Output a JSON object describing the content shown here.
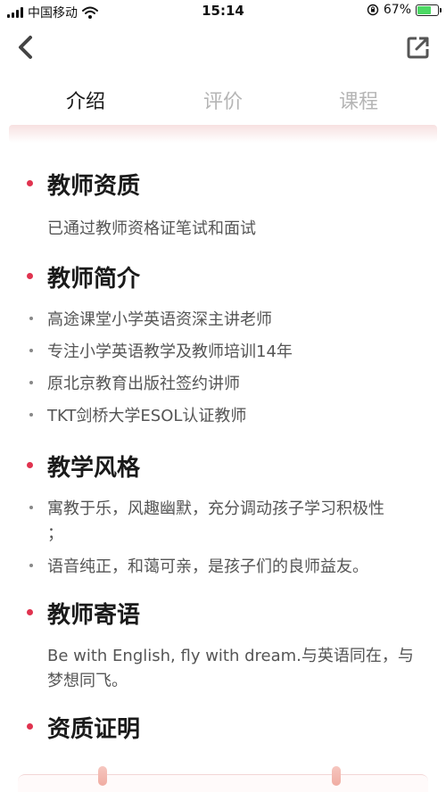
{
  "status_bar": {
    "carrier": "中国移动",
    "time": "15:14",
    "battery": "67%",
    "battery_level": 0.67
  },
  "tabs": [
    {
      "label": "介绍",
      "active": true
    },
    {
      "label": "评价",
      "active": false
    },
    {
      "label": "课程",
      "active": false
    }
  ],
  "colors": {
    "accent_dot": "#e0334f",
    "text_main": "#1a1a1a",
    "text_body": "#555555",
    "tab_inactive": "#b5b5b5"
  },
  "sections": {
    "qualification": {
      "title": "教师资质",
      "text": "已通过教师资格证笔试和面试"
    },
    "intro": {
      "title": "教师简介",
      "items": [
        "高途课堂小学英语资深主讲老师",
        "专注小学英语教学及教师培训14年",
        "原北京教育出版社签约讲师",
        "TKT剑桥大学ESOL认证教师"
      ]
    },
    "style": {
      "title": "教学风格",
      "items": [
        "寓教于乐，风趣幽默，充分调动孩子学习积极性",
        "；",
        "语音纯正，和蔼可亲，是孩子们的良师益友。"
      ]
    },
    "message": {
      "title": "教师寄语",
      "line1": "Be with English, fly with dream.与英语同在，与",
      "line2": "梦想同飞。"
    },
    "certificate": {
      "title": "资质证明"
    }
  },
  "icons": {
    "back": "back-arrow-icon",
    "share": "share-icon"
  }
}
